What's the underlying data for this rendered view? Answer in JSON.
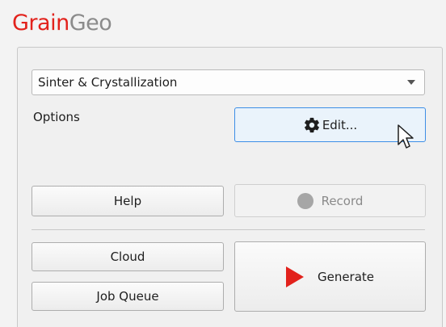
{
  "app": {
    "title_part1": "Grain",
    "title_part2": "Geo",
    "brand_red": "#e2221c",
    "brand_gray": "#8b8b8b"
  },
  "preset": {
    "selected": "Sinter & Crystallization"
  },
  "options": {
    "label": "Options",
    "edit_label": "Edit...",
    "edit_icon": "gear-icon"
  },
  "actions": {
    "help_label": "Help",
    "record_label": "Record",
    "record_icon": "record-dot-icon",
    "cloud_label": "Cloud",
    "job_queue_label": "Job Queue",
    "generate_label": "Generate",
    "generate_icon": "play-icon"
  }
}
